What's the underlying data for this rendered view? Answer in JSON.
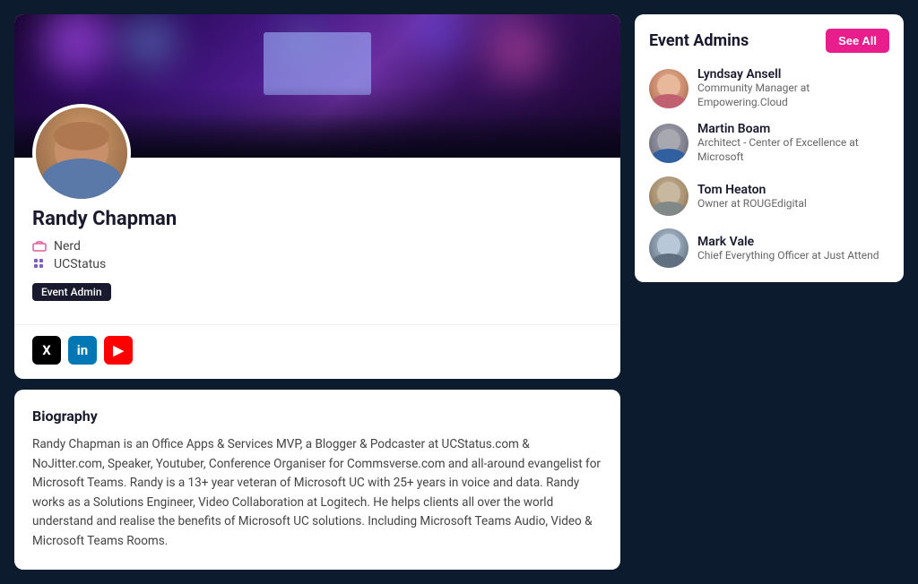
{
  "profile": {
    "name": "Randy Chapman",
    "title": "Nerd",
    "company": "UCStatus",
    "badge": "Event Admin",
    "biography_title": "Biography",
    "biography_text": "Randy Chapman is an Office Apps & Services MVP, a Blogger & Podcaster at UCStatus.com & NoJitter.com, Speaker, Youtuber, Conference Organiser for Commsverse.com and all-around evangelist for Microsoft Teams. Randy is a 13+ year veteran of Microsoft UC with 25+ years in voice and data. Randy works as a Solutions Engineer, Video Collaboration at Logitech. He helps clients all over the world understand and realise the benefits of Microsoft UC solutions. Including Microsoft Teams Audio, Video & Microsoft Teams Rooms.",
    "social": {
      "twitter_label": "X",
      "linkedin_label": "in",
      "youtube_label": "▶"
    }
  },
  "event_admins": {
    "title": "Event Admins",
    "see_all_label": "See All",
    "admins": [
      {
        "name": "Lyndsay Ansell",
        "role": "Community Manager at Empowering.Cloud",
        "avatar_class": "av-lyndsay",
        "head_color": "#e8b89a",
        "body_color": "#c06070"
      },
      {
        "name": "Martin Boam",
        "role": "Architect - Center of Excellence at Microsoft",
        "avatar_class": "av-martin",
        "head_color": "#a8a8b0",
        "body_color": "#3060a0"
      },
      {
        "name": "Tom Heaton",
        "role": "Owner at ROUGEdigital",
        "avatar_class": "av-tom",
        "head_color": "#c8b8a0",
        "body_color": "#808888"
      },
      {
        "name": "Mark Vale",
        "role": "Chief Everything Officer at Just Attend",
        "avatar_class": "av-mark",
        "head_color": "#b8c8d8",
        "body_color": "#607080"
      }
    ]
  }
}
